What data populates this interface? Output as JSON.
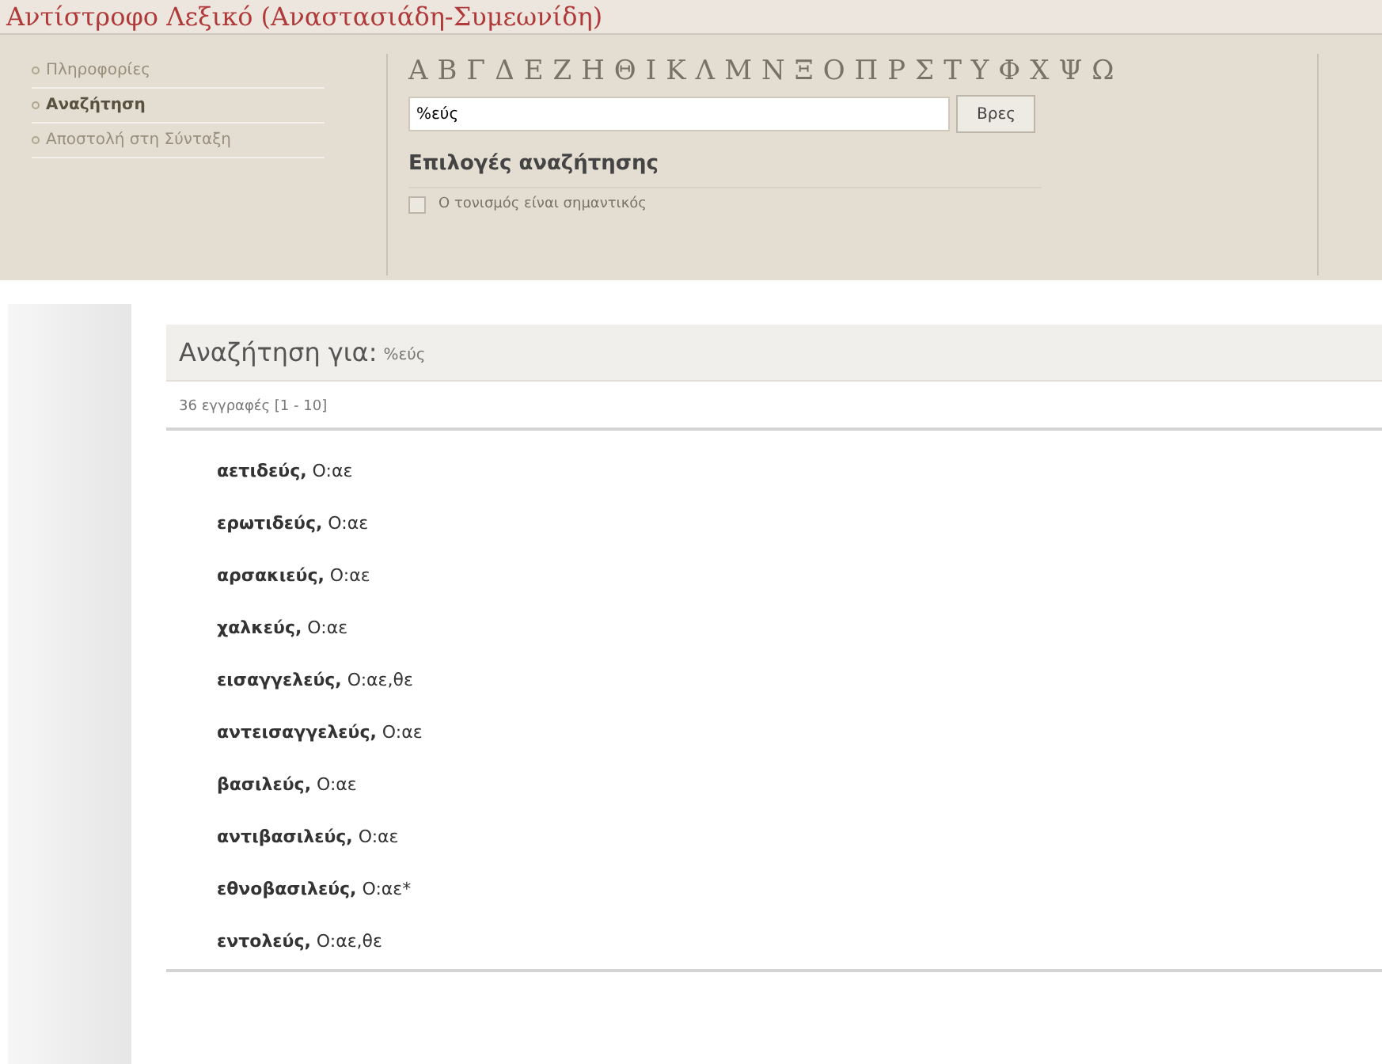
{
  "title": "Αντίστροφο Λεξικό (Αναστασιάδη-Συμεωνίδη)",
  "menu": [
    {
      "label": "Πληροφορίες",
      "selected": false
    },
    {
      "label": "Αναζήτηση",
      "selected": true
    },
    {
      "label": "Αποστολή στη Σύνταξη",
      "selected": false
    }
  ],
  "alphabet": [
    "Α",
    "Β",
    "Γ",
    "Δ",
    "Ε",
    "Ζ",
    "Η",
    "Θ",
    "Ι",
    "Κ",
    "Λ",
    "Μ",
    "Ν",
    "Ξ",
    "Ο",
    "Π",
    "Ρ",
    "Σ",
    "Τ",
    "Υ",
    "Φ",
    "Χ",
    "Ψ",
    "Ω"
  ],
  "search": {
    "value": "%εύς",
    "button": "Βρες"
  },
  "options": {
    "heading": "Επιλογές αναζήτησης",
    "checkbox": {
      "label": "Ο τονισμός είναι σημαντικός",
      "checked": false
    }
  },
  "results": {
    "heading": "Αναζήτηση για:",
    "query": "%εύς",
    "count": "36 εγγραφές [1 - 10]",
    "entries": [
      "**αετιδεύς,** O:αε",
      "**ερωτιδεύς,** O:αε",
      "**αρσακιεύς,** O:αε",
      "**χαλκεύς,** O:αε",
      "**εισαγγελεύς,** O:αε,θε",
      "**αντεισαγγελεύς,** O:αε",
      "**βασιλεύς,** O:αε",
      "**αντιβασιλεύς,** O:αε",
      "**εθνοβασιλεύς,** O:αε*",
      "**εντολεύς,** O:αε,θε"
    ]
  }
}
